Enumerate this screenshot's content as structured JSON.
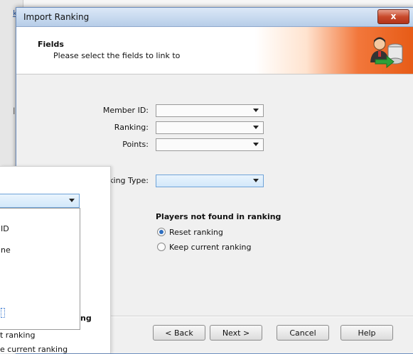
{
  "background": {
    "fragment_k": "k",
    "fragment_ld": "ld"
  },
  "dialog": {
    "title": "Import Ranking",
    "close_glyph": "x",
    "header": {
      "title": "Fields",
      "subtitle": "Please select the fields to link to",
      "icon": "user-database-import-icon"
    },
    "fields": [
      {
        "label": "Member ID:",
        "value": ""
      },
      {
        "label": "Ranking:",
        "value": ""
      },
      {
        "label": "Points:",
        "value": ""
      },
      {
        "label": "king Type:",
        "value": ""
      }
    ],
    "section_title": "Players not found in ranking",
    "options": [
      {
        "label": "Reset ranking",
        "selected": true
      },
      {
        "label": "Keep current ranking",
        "selected": false
      }
    ],
    "buttons": {
      "back": "< Back",
      "next": "Next >",
      "cancel": "Cancel",
      "help": "Help"
    }
  },
  "overlay": {
    "list_items": [
      "ID",
      "ne"
    ],
    "section_fragment": "ng",
    "radio_fragment_1": "t ranking",
    "radio_fragment_2": "e current ranking"
  },
  "colors": {
    "accent": "#e75b16",
    "title_bar": "#b7cde8",
    "selection": "#2e6ebf"
  }
}
